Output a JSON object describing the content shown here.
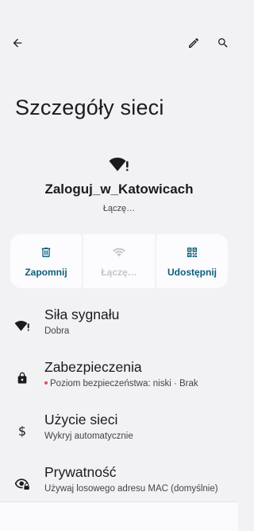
{
  "icons": {
    "back": "arrow-back-icon",
    "edit": "pencil-icon",
    "search": "search-icon"
  },
  "page": {
    "title": "Szczegóły sieci"
  },
  "network": {
    "ssid": "Zaloguj_w_Katowicach",
    "status": "Łączę…"
  },
  "actions": [
    {
      "label": "Zapomnij",
      "icon": "trash-icon",
      "enabled": true
    },
    {
      "label": "Łączę…",
      "icon": "wifi-icon",
      "enabled": false
    },
    {
      "label": "Udostępnij",
      "icon": "qr-code-icon",
      "enabled": true
    }
  ],
  "details": [
    {
      "title": "Siła sygnału",
      "subtitle": "Dobra",
      "icon": "wifi-alert-icon"
    },
    {
      "title": "Zabezpieczenia",
      "subtitle": "Poziom bezpieczeństwa: niski · Brak",
      "icon": "lock-icon"
    },
    {
      "title": "Użycie sieci",
      "subtitle": "Wykryj automatycznie",
      "icon": "dollar-icon"
    },
    {
      "title": "Prywatność",
      "subtitle": "Używaj losowego adresu MAC (domyślnie)",
      "icon": "eye-lock-icon"
    }
  ],
  "colors": {
    "accent": "#0b5d7a",
    "disabled": "#c3c6cb",
    "background": "#f2f2f4",
    "card": "#fcfcfe",
    "security_dot": "#d94f5c"
  }
}
